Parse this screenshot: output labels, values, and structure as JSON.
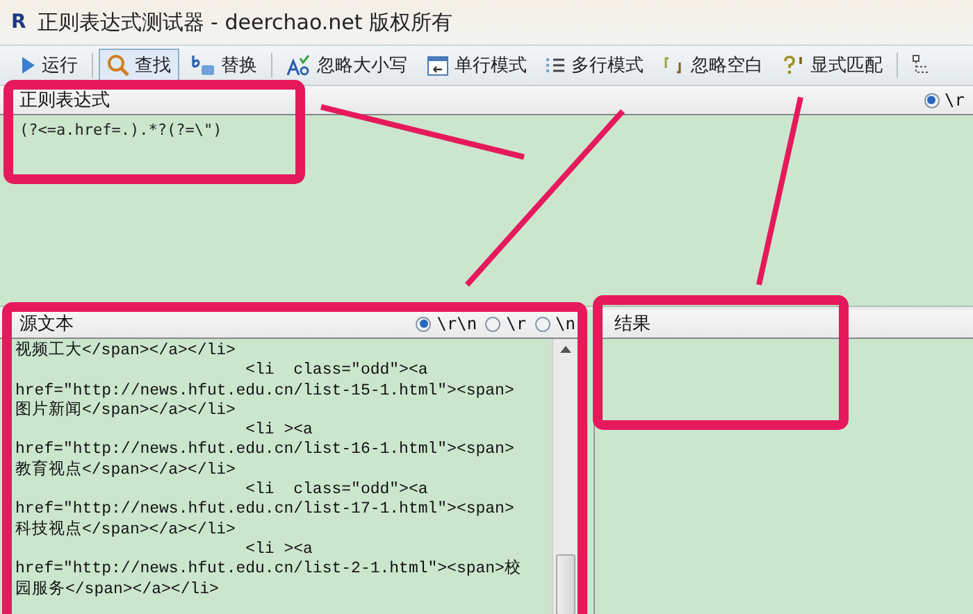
{
  "window": {
    "icon_letter": "R",
    "title": "正则表达式测试器 - deerchao.net 版权所有"
  },
  "toolbar": [
    {
      "kind": "run",
      "label": "运行",
      "selected": false
    },
    {
      "kind": "find",
      "label": "查找",
      "selected": true
    },
    {
      "kind": "replace",
      "label": "替换",
      "selected": false
    },
    {
      "kind": "ignore-case",
      "label": "忽略大小写",
      "selected": false
    },
    {
      "kind": "single-line",
      "label": "单行模式",
      "selected": false
    },
    {
      "kind": "multi-line",
      "label": "多行模式",
      "selected": false
    },
    {
      "kind": "ignore-space",
      "label": "忽略空白",
      "selected": false
    },
    {
      "kind": "explicit",
      "label": "显式匹配",
      "selected": false
    },
    {
      "kind": "tree",
      "selected": false
    }
  ],
  "regex_panel": {
    "title": "正则表达式",
    "newline_options": [
      {
        "label": "\\r",
        "selected": true
      }
    ],
    "value": "(?<=a.href=.).*?(?=\\\")"
  },
  "source_panel": {
    "title": "源文本",
    "newline_options": [
      {
        "label": "\\r\\n",
        "selected": true
      },
      {
        "label": "\\r",
        "selected": false
      },
      {
        "label": "\\n",
        "selected": false
      }
    ],
    "lines": [
      "视频工大</span></a></li>",
      "                        <li  class=\"odd\"><a",
      "href=\"http://news.hfut.edu.cn/list-15-1.html\"><span>",
      "图片新闻</span></a></li>",
      "                        <li ><a",
      "href=\"http://news.hfut.edu.cn/list-16-1.html\"><span>",
      "教育视点</span></a></li>",
      "                        <li  class=\"odd\"><a",
      "href=\"http://news.hfut.edu.cn/list-17-1.html\"><span>",
      "科技视点</span></a></li>",
      "                        <li ><a",
      "href=\"http://news.hfut.edu.cn/list-2-1.html\"><span>校",
      "园服务</span></a></li>"
    ]
  },
  "result_panel": {
    "title": "结果"
  }
}
